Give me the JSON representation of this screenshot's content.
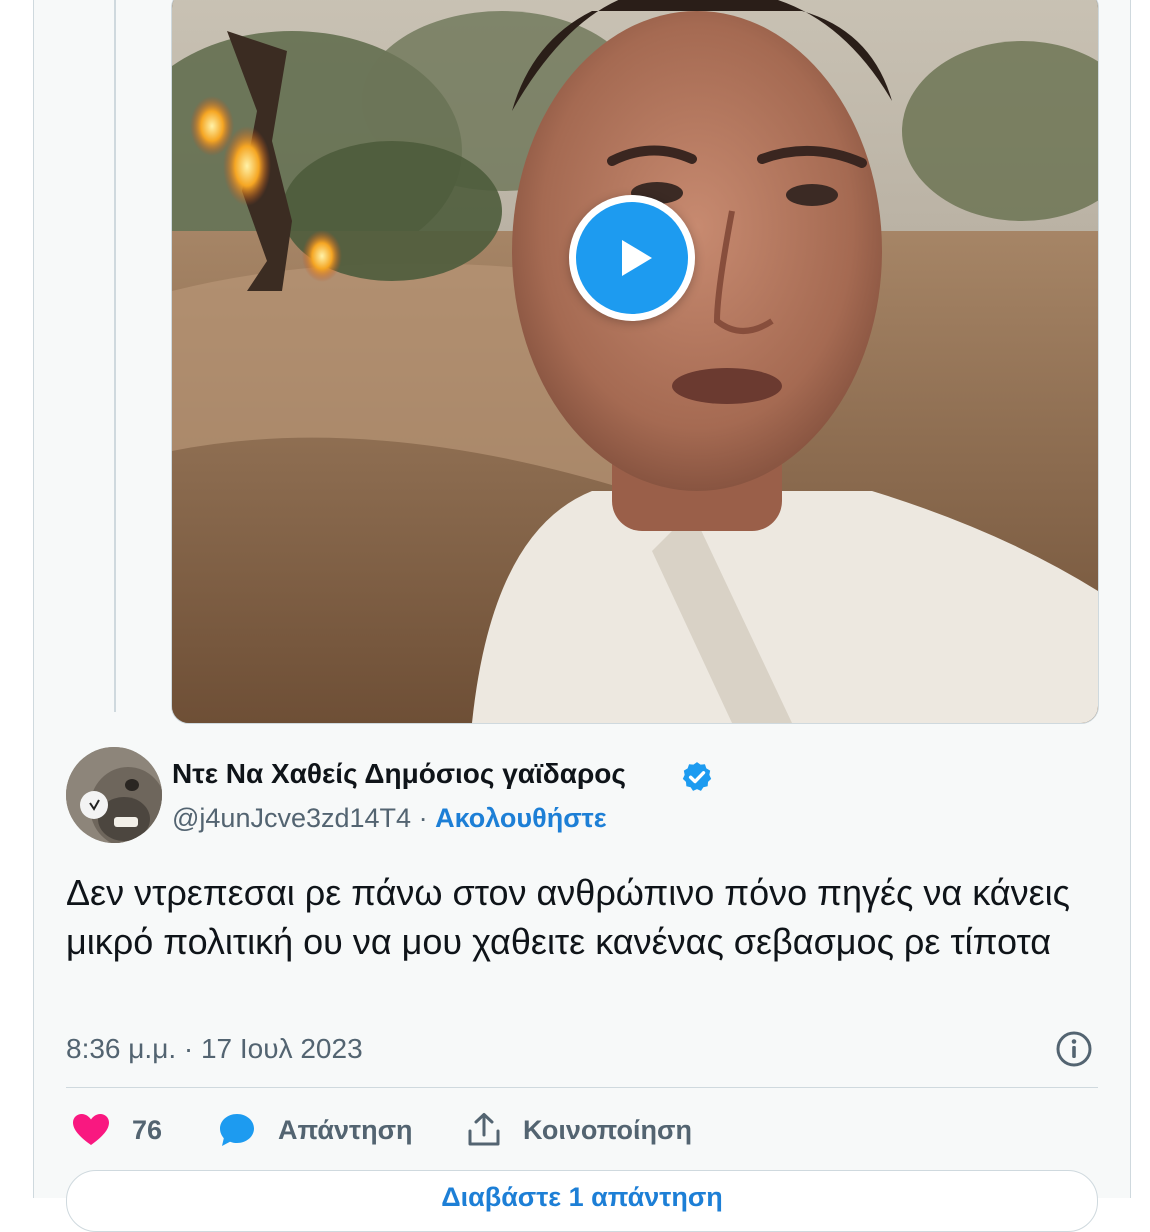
{
  "video": {
    "play_icon": "play-icon"
  },
  "author": {
    "display_name": "Ντε Να Χαθείς Δημόσιος γαϊδαρος",
    "handle": "@j4unJcve3zd14T4",
    "separator": "·",
    "follow_label": "Ακολουθήστε",
    "verified_icon": "verified-badge-icon"
  },
  "tweet": {
    "text": "Δεν ντρεπεσαι ρε πάνω στον ανθρώπινο πόνο πηγές να κάνεις μικρό πολιτική ου να μου χαθειτε κανένας σεβασμος ρε τίποτα",
    "timestamp": "8:36 μ.μ. · 17 Ιουλ 2023"
  },
  "actions": {
    "like_count": "76",
    "reply_label": "Απάντηση",
    "share_label": "Κοινοποίηση"
  },
  "bottom_button": {
    "label": "Διαβάστε 1 απάντηση"
  },
  "colors": {
    "accent": "#1d9bf0",
    "like": "#f91880",
    "secondary_text": "#536471",
    "card_bg": "#f7f9f9"
  }
}
